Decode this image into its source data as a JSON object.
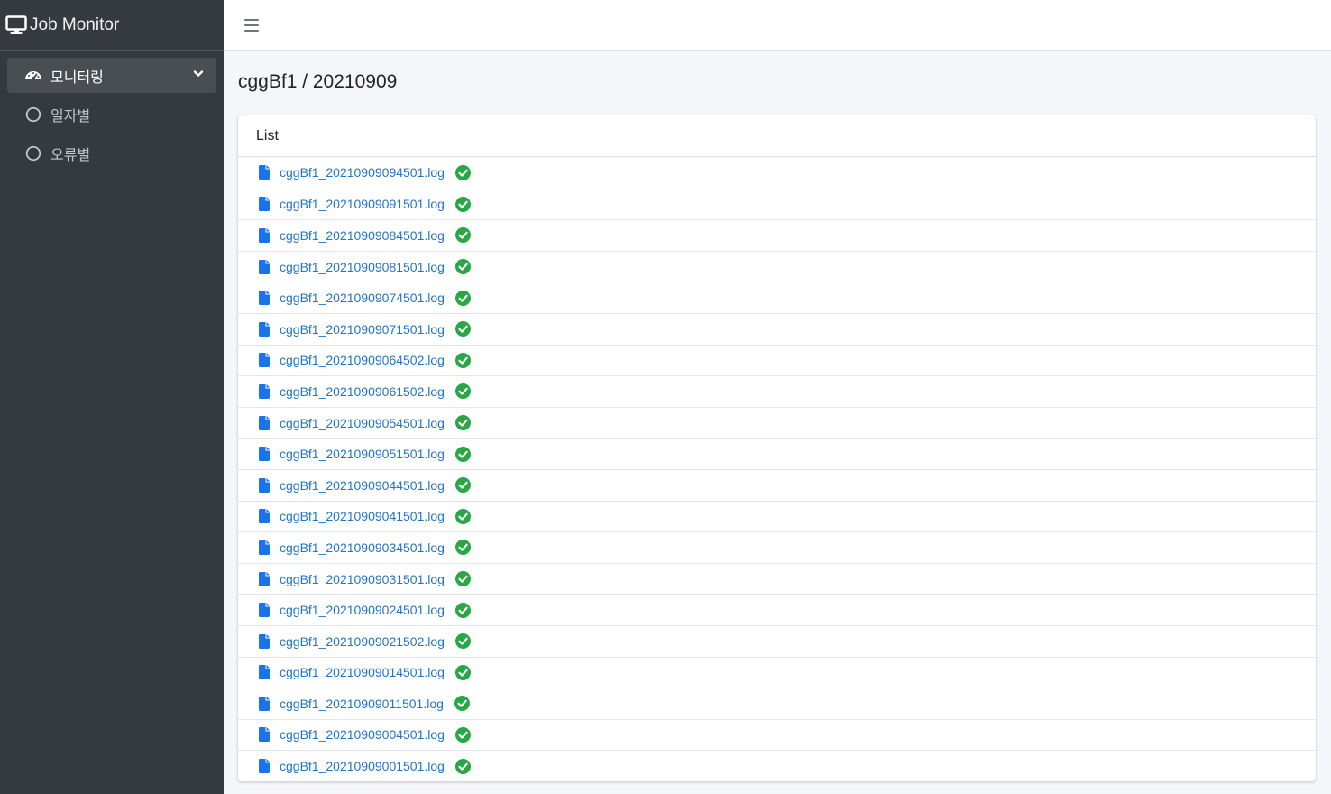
{
  "brand": {
    "title": "Job Monitor",
    "icon": "desktop-icon"
  },
  "sidebar": {
    "items": [
      {
        "label": "모니터링",
        "icon": "tachometer-icon",
        "active": true,
        "expanded": true
      },
      {
        "label": "일자별",
        "icon": "circle-icon",
        "active": false
      },
      {
        "label": "오류별",
        "icon": "circle-icon",
        "active": false
      }
    ]
  },
  "header": {
    "menu_icon": "hamburger-icon"
  },
  "page": {
    "title": "cggBf1 / 20210909"
  },
  "card": {
    "title": "List",
    "files": [
      "cggBf1_20210909094501.log",
      "cggBf1_20210909091501.log",
      "cggBf1_20210909084501.log",
      "cggBf1_20210909081501.log",
      "cggBf1_20210909074501.log",
      "cggBf1_20210909071501.log",
      "cggBf1_20210909064502.log",
      "cggBf1_20210909061502.log",
      "cggBf1_20210909054501.log",
      "cggBf1_20210909051501.log",
      "cggBf1_20210909044501.log",
      "cggBf1_20210909041501.log",
      "cggBf1_20210909034501.log",
      "cggBf1_20210909031501.log",
      "cggBf1_20210909024501.log",
      "cggBf1_20210909021502.log",
      "cggBf1_20210909014501.log",
      "cggBf1_20210909011501.log",
      "cggBf1_20210909004501.log",
      "cggBf1_20210909001501.log"
    ],
    "status": "success",
    "status_icon": "check-circle-icon"
  },
  "colors": {
    "sidebar_bg": "#343a40",
    "link": "#1f75c7",
    "success": "#28a745",
    "file_icon": "#1a73e8"
  }
}
